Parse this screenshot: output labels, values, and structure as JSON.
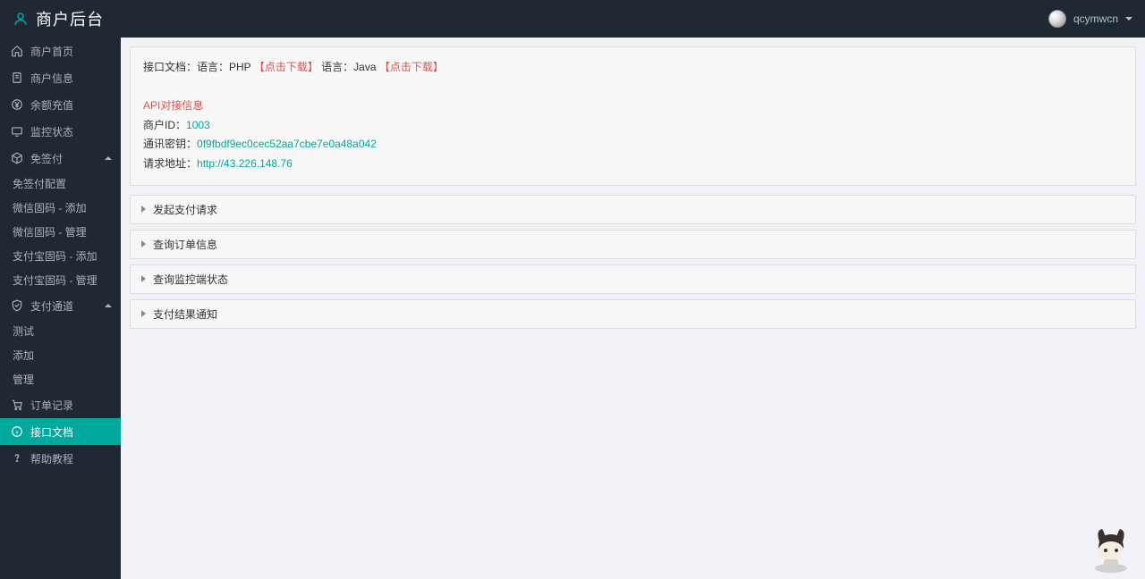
{
  "header": {
    "brand_title": "商户后台",
    "username": "qcymwcn"
  },
  "sidebar": {
    "home": "商户首页",
    "merchant_info": "商户信息",
    "balance_recharge": "余额充值",
    "monitor_status": "监控状态",
    "exempt_sign": "免签付",
    "exempt_sign_items": [
      "免签付配置",
      "微信固码 - 添加",
      "微信固码 - 管理",
      "支付宝固码 - 添加",
      "支付宝固码 - 管理"
    ],
    "pay_channel": "支付通道",
    "pay_channel_items": [
      "测试",
      "添加",
      "管理"
    ],
    "order_log": "订单记录",
    "api_doc": "接口文档",
    "help": "帮助教程"
  },
  "panel": {
    "doc_prefix": "接口文档：语言：PHP",
    "download1": "【点击下载】",
    "lang_java": "语言：Java",
    "download2": "【点击下载】",
    "api_title": "API对接信息",
    "mid_label": "商户ID：",
    "mid_val": "1003",
    "key_label": "通讯密钥：",
    "key_val": "0f9fbdf9ec0cec52aa7cbe7e0a48a042",
    "url_label": "请求地址：",
    "url_val": "http://43.226.148.76"
  },
  "accordion": [
    "发起支付请求",
    "查询订单信息",
    "查询监控端状态",
    "支付结果通知"
  ]
}
